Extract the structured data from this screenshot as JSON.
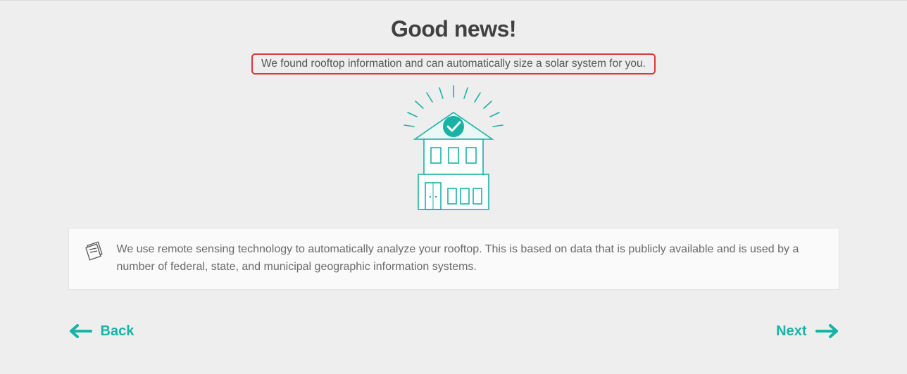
{
  "heading": "Good news!",
  "subtitle": "We found rooftop information and can automatically size a solar system for you.",
  "info_text": "We use remote sensing technology to automatically analyze your rooftop. This is based on data that is publicly available and is used by a number of federal, state, and municipal geographic information systems.",
  "nav": {
    "back_label": "Back",
    "next_label": "Next"
  },
  "colors": {
    "accent": "#19b3a6",
    "highlight_border": "#d73a3a"
  }
}
